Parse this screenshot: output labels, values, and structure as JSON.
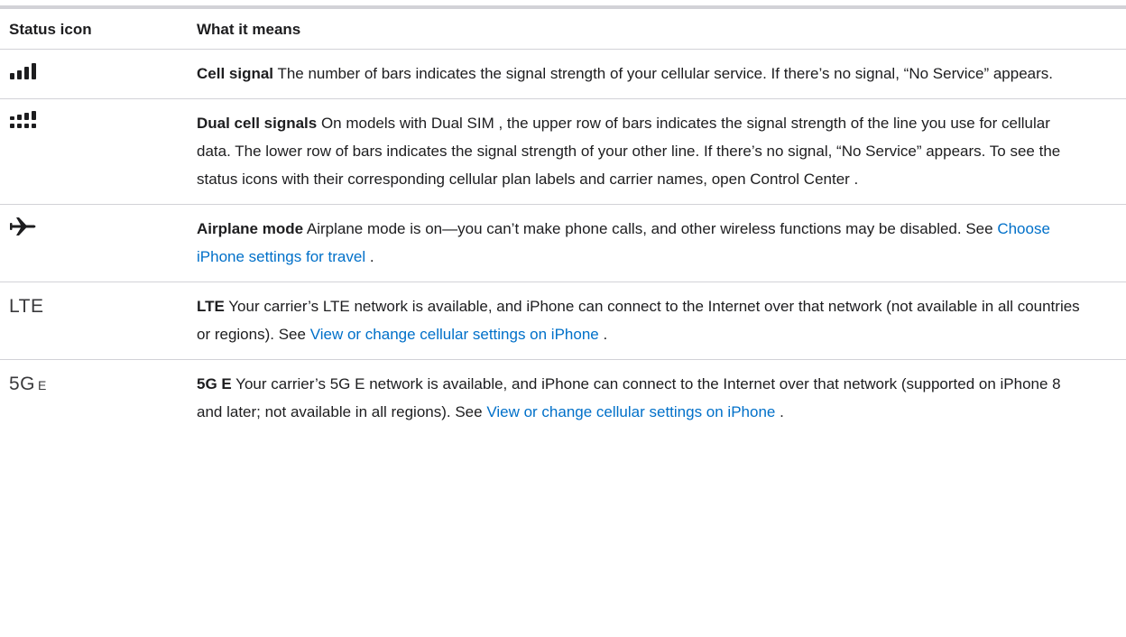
{
  "table": {
    "header": {
      "icon_col": "Status icon",
      "desc_col": "What it means"
    },
    "rows": [
      {
        "icon": "cell-signal-icon",
        "term": "Cell signal",
        "description": " The number of bars indicates the signal strength of your cellular service. If there’s no signal, “No Service” appears."
      },
      {
        "icon": "dual-cell-signal-icon",
        "term": "Dual cell signals",
        "description": " On models with Dual SIM , the upper row of bars indicates the signal strength of the line you use for cellular data. The lower row of bars indicates the signal strength of your other line. If there’s no signal, “No Service” appears. To see the status icons with their corresponding cellular plan labels and carrier names, open Control Center ."
      },
      {
        "icon": "airplane-icon",
        "term": "Airplane mode",
        "description": " Airplane mode is on—you can’t make phone calls, and other wireless functions may be disabled. See ",
        "link": "Choose iPhone settings for travel",
        "after": " ."
      },
      {
        "icon_text": "LTE",
        "term": "LTE",
        "description": " Your carrier’s LTE network is available, and iPhone can connect to the Internet over that network (not available in all countries or regions). See ",
        "link": "View or change cellular settings on iPhone",
        "after": " ."
      },
      {
        "icon_text_main": "5G",
        "icon_text_sub": "E",
        "term": "5G E",
        "description": " Your carrier’s 5G E network is available, and iPhone can connect to the Internet over that network (supported on iPhone 8 and later; not available in all regions). See ",
        "link": "View or change cellular settings on iPhone",
        "after": " ."
      }
    ]
  },
  "colors": {
    "link": "#0070c9",
    "rule": "#d2d2d7",
    "text": "#1d1d1f"
  }
}
